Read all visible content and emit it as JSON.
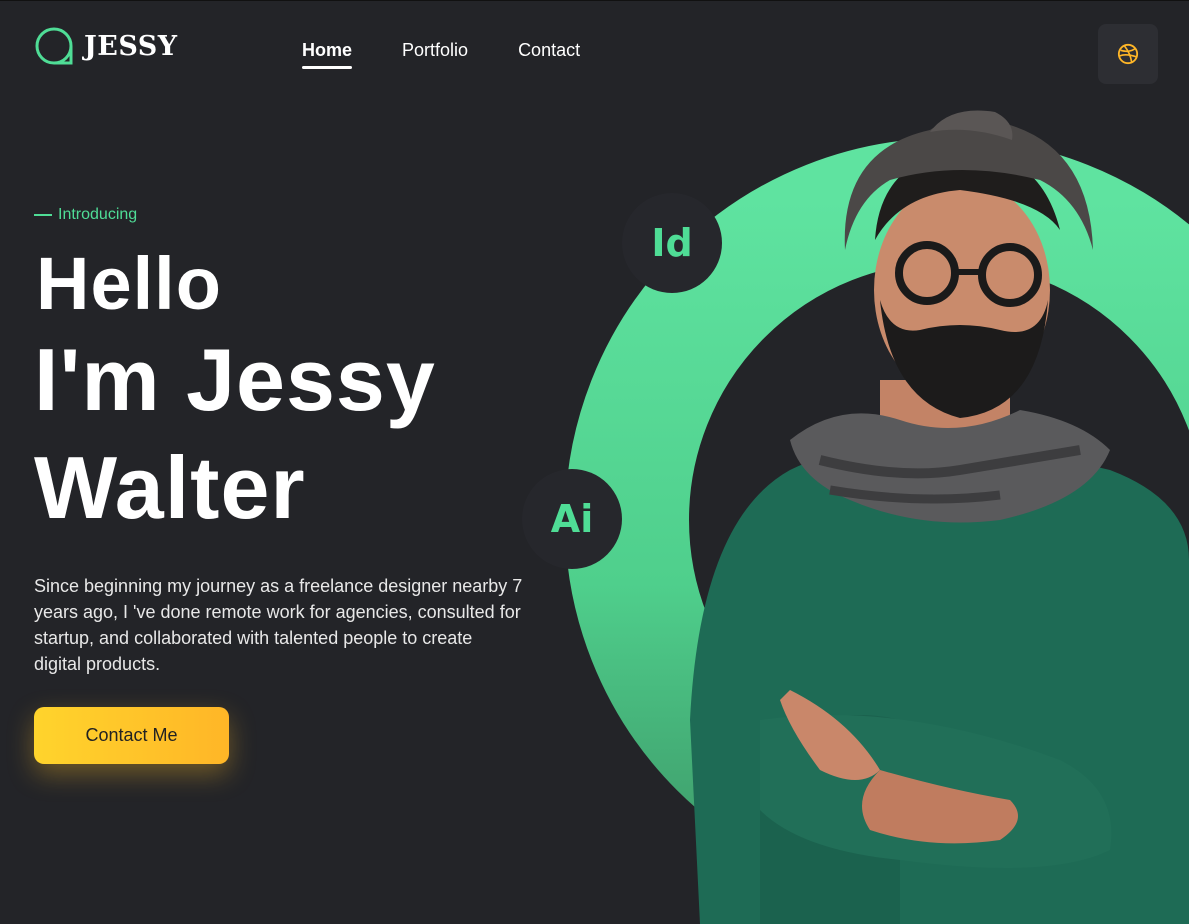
{
  "header": {
    "logo_text": "JESSY",
    "nav": [
      {
        "label": "Home",
        "active": true
      },
      {
        "label": "Portfolio",
        "active": false
      },
      {
        "label": "Contact",
        "active": false
      }
    ],
    "social_icon": "dribbble-icon"
  },
  "hero": {
    "eyebrow": "Introducing",
    "greeting": "Hello",
    "name_line1": "I'm Jessy",
    "name_line2": "Walter",
    "description": "Since beginning my journey as a freelance designer nearby 7 years ago, I 've done remote work for agencies, consulted for startup, and collaborated with talented people to create digital products.",
    "cta_label": "Contact Me"
  },
  "badges": {
    "indesign": "Id",
    "illustrator": "Ai"
  },
  "colors": {
    "background": "#232428",
    "accent_green": "#4fdd96",
    "cta_yellow": "#ffc22a",
    "badge_bg": "#26272c"
  }
}
